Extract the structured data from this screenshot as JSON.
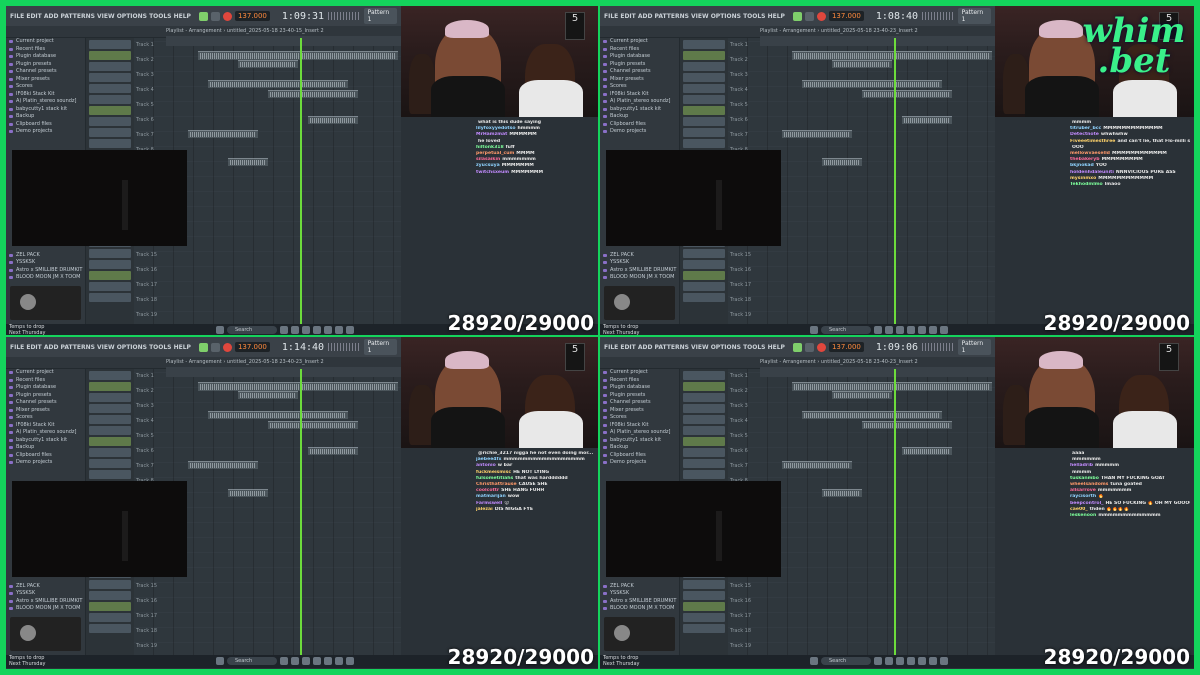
{
  "colors": {
    "border": "#14d45c",
    "playhead": "#6ddb3c",
    "brand": "#3af08a"
  },
  "brand_logo": {
    "text_line1": "whim",
    "text_line2": ".bet"
  },
  "quadrants": [
    {
      "menu": "FILE EDIT ADD PATTERNS VIEW OPTIONS TOOLS HELP",
      "bpm": "137.000",
      "clock": "1:09:31",
      "pattern": "Pattern 1",
      "playlist_title": "Playlist - Arrangement › untitled_2025-05-18 23-40-15_Insert 2",
      "browser": [
        "Current project",
        "Recent files",
        "Plugin database",
        "Plugin presets",
        "Channel presets",
        "Mixer presets",
        "Scores",
        "IF08ki Stack Kit",
        "A) Platin_stereo soundz]",
        "babycutty1 stack kit",
        "Backup",
        "Clipboard files",
        "Demo projects"
      ],
      "browser_bottom": [
        "ZEL PACK",
        "YSSKSK",
        "Astro x SMILLIBE DRUMKIT",
        "BLOOD MOON JM X TOOM"
      ],
      "status": [
        "Temps to drop",
        "Next Thursday"
      ],
      "counter": "28920/29000",
      "chat": [
        {
          "u": "",
          "m": "what is this dude saying"
        },
        {
          "u": "lilyfoxyyedotso",
          "m": "hmmmm"
        },
        {
          "u": "MrHamzmat",
          "m": "MMMMMM"
        },
        {
          "u": "",
          "m": "he loved"
        },
        {
          "u": "hiltonk318",
          "m": "fuff"
        },
        {
          "u": "perpetual_cum",
          "m": "MMMM"
        },
        {
          "u": "silasaikin",
          "m": "mmmmmmm"
        },
        {
          "u": "zyucsuya",
          "m": "MMMMMMM"
        },
        {
          "u": "twitchsxeum",
          "m": "MMMMMMM"
        }
      ],
      "playhead_pct": 0.62
    },
    {
      "menu": "FILE EDIT ADD PATTERNS VIEW OPTIONS TOOLS HELP",
      "bpm": "137.000",
      "clock": "1:08:40",
      "pattern": "Pattern 1",
      "playlist_title": "Playlist - Arrangement › untitled_2025-05-18 23-40-23_Insert 2",
      "browser": [
        "Current project",
        "Recent files",
        "Plugin database",
        "Plugin presets",
        "Channel presets",
        "Mixer presets",
        "Scores",
        "IF08ki Stack Kit",
        "A) Platin_stereo soundz]",
        "babycutty1 stack kit",
        "Backup",
        "Clipboard files",
        "Demo projects"
      ],
      "browser_bottom": [
        "ZEL PACK",
        "YSSKSK",
        "Astro x SMILLIBE DRUMKIT",
        "BLOOD MOON JM X TOOM"
      ],
      "status": [
        "Temps to drop",
        "Next Thursday"
      ],
      "counter": "28920/29000",
      "chat": [
        {
          "u": "",
          "m": "mmmm"
        },
        {
          "u": "titruber_bcc",
          "m": "MMMMMMMMMMMMM"
        },
        {
          "u": "Detectnote",
          "m": "whwhwhw"
        },
        {
          "u": "Fiveeetimesthree",
          "m": "and can't lie, that Flo-milli shit was a vibe tho"
        },
        {
          "u": "",
          "m": "OOO"
        },
        {
          "u": "mellowvaeselld",
          "m": "MMMMMMMMMMMM"
        },
        {
          "u": "thebakeryb",
          "m": "MMMMMMMMM"
        },
        {
          "u": "bkjnokad",
          "m": "YOO"
        },
        {
          "u": "holdenhdaleuniti",
          "m": "NNNVICIOUS PURE ASS"
        },
        {
          "u": "mysinmxo",
          "m": "MMMMMMMMMMMM"
        },
        {
          "u": "Tekhodmlmo",
          "m": "lmaoo"
        }
      ],
      "playhead_pct": 0.62
    },
    {
      "menu": "FILE EDIT ADD PATTERNS VIEW OPTIONS TOOLS HELP",
      "bpm": "137.000",
      "clock": "1:14:40",
      "pattern": "Pattern 1",
      "playlist_title": "Playlist - Arrangement › untitled_2025-05-18 23-40-23_Insert 2",
      "browser": [
        "Current project",
        "Recent files",
        "Plugin database",
        "Plugin presets",
        "Channel presets",
        "Mixer presets",
        "Scores",
        "IF08ki Stack Kit",
        "A) Platin_stereo soundz]",
        "babycutty1 stack kit",
        "Backup",
        "Clipboard files",
        "Demo projects"
      ],
      "browser_bottom": [
        "ZEL PACK",
        "YSSKSK",
        "Astro x SMILLIBE DRUMKIT",
        "BLOOD MOON JM X TOOM"
      ],
      "status": [
        "Temps to drop",
        "Next Thursday"
      ],
      "counter": "28920/29000",
      "chat": [
        {
          "u": "",
          "m": "@richie_3217 nigga he not even doing mor..."
        },
        {
          "u": "jaebee4fx",
          "m": "mmmmmmmmmmmmmmmmm"
        },
        {
          "u": "antonio",
          "m": "w bar"
        },
        {
          "u": "fuckmeismisc",
          "m": "HE NOT LYING"
        },
        {
          "u": "fulsometitiahs",
          "m": "that was hardddddd"
        },
        {
          "u": "Christhattrause",
          "m": "CAUSE SHE"
        },
        {
          "u": "coolcottr",
          "m": "SHE HANG FUHH"
        },
        {
          "u": "matmarijan",
          "m": "wow"
        },
        {
          "u": "Farmswell",
          "m": "😮"
        },
        {
          "u": "jalezai",
          "m": "DIS NIGGA FYE"
        }
      ],
      "playhead_pct": 0.62
    },
    {
      "menu": "FILE EDIT ADD PATTERNS VIEW OPTIONS TOOLS HELP",
      "bpm": "137.000",
      "clock": "1:09:06",
      "pattern": "Pattern 1",
      "playlist_title": "Playlist - Arrangement › untitled_2025-05-18 23-40-23_Insert 2",
      "browser": [
        "Current project",
        "Recent files",
        "Plugin database",
        "Plugin presets",
        "Channel presets",
        "Mixer presets",
        "Scores",
        "IF08ki Stack Kit",
        "A) Platin_stereo soundz]",
        "babycutty1 stack kit",
        "Backup",
        "Clipboard files",
        "Demo projects"
      ],
      "browser_bottom": [
        "ZEL PACK",
        "YSSKSK",
        "Astro x SMILLIBE DRUMKIT",
        "BLOOD MOON JM X TOOM"
      ],
      "status": [
        "Temps to drop",
        "Next Thursday"
      ],
      "counter": "28920/29000",
      "chat": [
        {
          "u": "",
          "m": "aaaa"
        },
        {
          "u": "",
          "m": "mmmmmm"
        },
        {
          "u": "helladrib",
          "m": "mmmmm"
        },
        {
          "u": "",
          "m": "mmmm"
        },
        {
          "u": "tuskanmbo",
          "m": "THAN MY FUCKING GOAT"
        },
        {
          "u": "wheelsandoms",
          "m": "tuna goated"
        },
        {
          "u": "allsarrove",
          "m": "mmmmmmm"
        },
        {
          "u": "raycisorth",
          "m": "🔥"
        },
        {
          "u": "beepcontrol_",
          "m": "HE SO FUCKING 🔥 OH MY GOOOOOOD"
        },
        {
          "u": "cae00_",
          "m": "thden 🔥🔥🔥🔥"
        },
        {
          "u": "leskenoon",
          "m": "mmmmmmmmmmmmm"
        }
      ],
      "playhead_pct": 0.62
    }
  ]
}
